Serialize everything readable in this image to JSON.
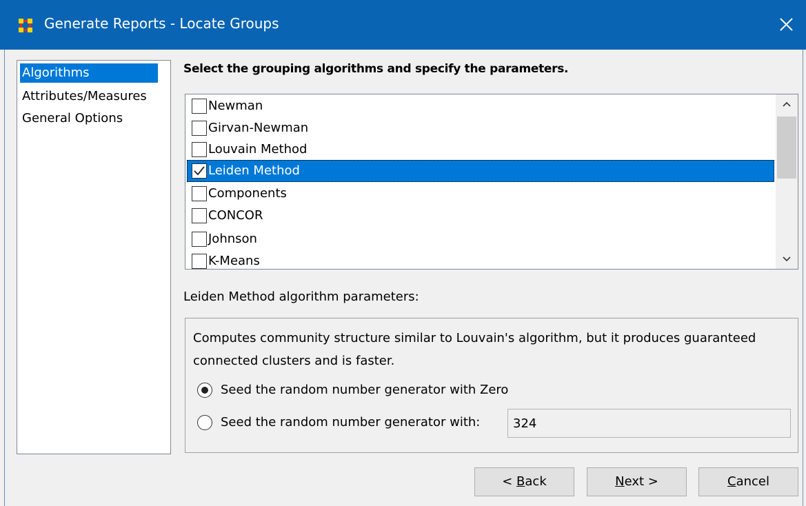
{
  "window": {
    "title": "Generate Reports - Locate Groups",
    "titlebar_color": "#0a64b4"
  },
  "icons": {
    "app": "app-grid-icon",
    "close": "close-icon",
    "check": "checkmark-icon",
    "scroll_up": "chevron-up-icon",
    "scroll_down": "chevron-down-icon"
  },
  "nav": {
    "items": [
      {
        "label": "Algorithms",
        "selected": true
      },
      {
        "label": "Attributes/Measures",
        "selected": false
      },
      {
        "label": "General Options",
        "selected": false
      }
    ]
  },
  "main": {
    "heading": "Select the grouping algorithms and specify the parameters.",
    "algorithms": [
      {
        "label": "Newman",
        "checked": false,
        "selected": false
      },
      {
        "label": "Girvan-Newman",
        "checked": false,
        "selected": false
      },
      {
        "label": "Louvain Method",
        "checked": false,
        "selected": false
      },
      {
        "label": "Leiden Method",
        "checked": true,
        "selected": true
      },
      {
        "label": "Components",
        "checked": false,
        "selected": false
      },
      {
        "label": "CONCOR",
        "checked": false,
        "selected": false
      },
      {
        "label": "Johnson",
        "checked": false,
        "selected": false
      },
      {
        "label": "K-Means",
        "checked": false,
        "selected": false
      }
    ],
    "params_label": "Leiden Method algorithm parameters:",
    "description": "Computes community structure similar to Louvain's algorithm, but it produces guaranteed connected clusters and is faster.",
    "seed_options": [
      {
        "label": "Seed the random number generator with Zero",
        "selected": true
      },
      {
        "label": "Seed the random number generator with:",
        "selected": false
      }
    ],
    "seed_value": "324"
  },
  "buttons": {
    "back": {
      "prefix": "< ",
      "mnemonic": "B",
      "rest": "ack"
    },
    "next": {
      "prefix": "",
      "mnemonic": "N",
      "rest": "ext >"
    },
    "cancel": {
      "prefix": "",
      "mnemonic": "C",
      "rest": "ancel"
    }
  },
  "colors": {
    "selection": "#0078d7",
    "window_bg": "#f0f0f0"
  }
}
